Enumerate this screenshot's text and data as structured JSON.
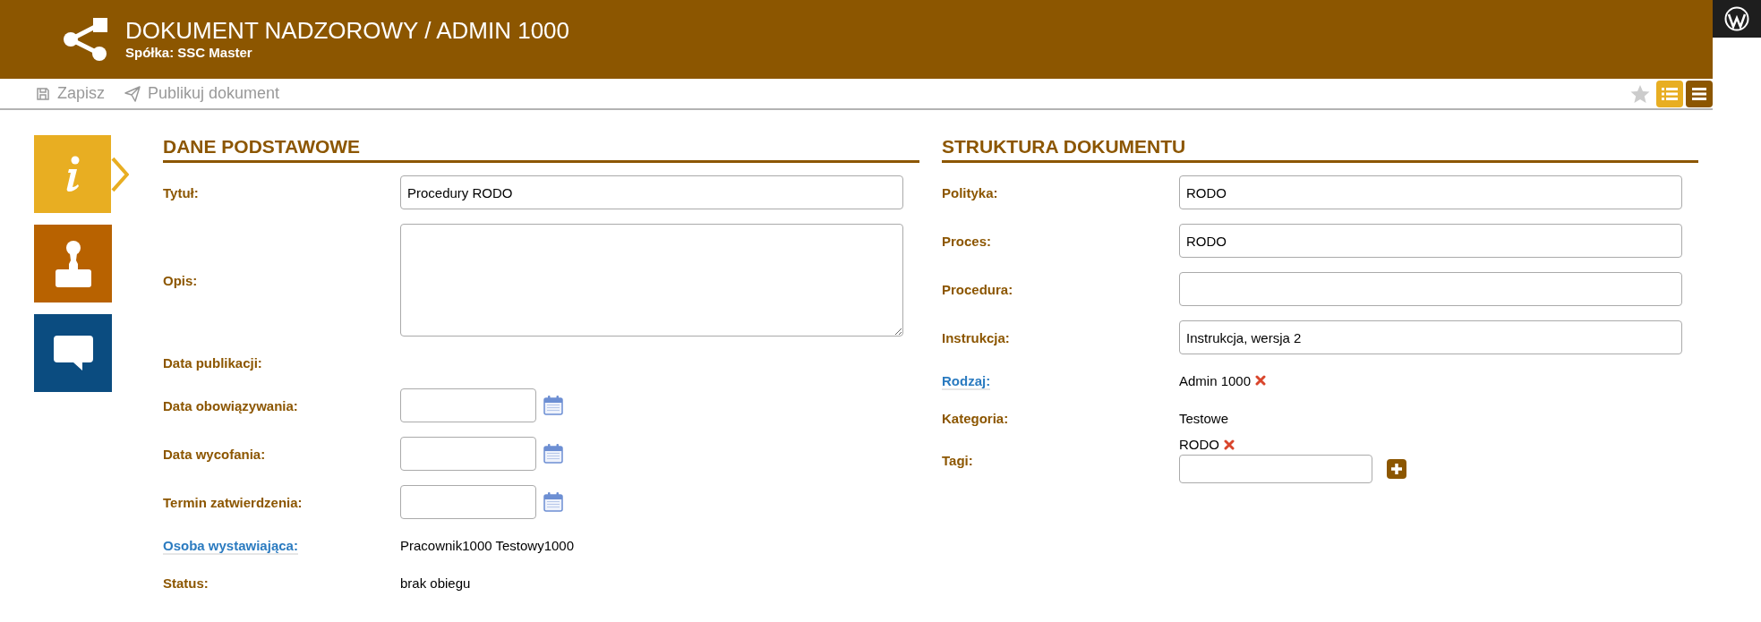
{
  "header": {
    "title": "DOKUMENT NADZOROWY / ADMIN 1000",
    "subtitle": "Spółka: SSC Master"
  },
  "toolbar": {
    "actions": [
      {
        "kind": "save",
        "label": "Zapisz"
      },
      {
        "kind": "publish",
        "label": "Publikuj dokument"
      }
    ],
    "view_buttons": [
      {
        "kind": "star",
        "selected": false
      },
      {
        "kind": "list",
        "selected": true
      },
      {
        "kind": "menu",
        "selected": false
      }
    ]
  },
  "side_nav": [
    {
      "kind": "info",
      "selected": true
    },
    {
      "kind": "stamp",
      "selected": false
    },
    {
      "kind": "comment",
      "selected": false
    }
  ],
  "sections": [
    {
      "title": "DANE PODSTAWOWE",
      "fields": [
        {
          "label": "Tytuł:",
          "kind": "input",
          "value": "Procedury RODO",
          "link": false
        },
        {
          "label": "Opis:",
          "kind": "textarea",
          "link": false
        },
        {
          "label": "Data publikacji:",
          "kind": "empty",
          "link": false
        },
        {
          "label": "Data obowiązywania:",
          "kind": "date",
          "link": false
        },
        {
          "label": "Data wycofania:",
          "kind": "date",
          "link": false
        },
        {
          "label": "Termin zatwierdzenia:",
          "kind": "date",
          "link": false
        },
        {
          "label": "Osoba wystawiająca:",
          "kind": "text",
          "value": "Pracownik1000 Testowy1000",
          "link": true
        },
        {
          "label": "Status:",
          "kind": "text",
          "value": "brak obiegu",
          "link": false
        }
      ]
    },
    {
      "title": "STRUKTURA DOKUMENTU",
      "fields": [
        {
          "label": "Polityka:",
          "kind": "input",
          "value": "RODO",
          "link": false
        },
        {
          "label": "Proces:",
          "kind": "input",
          "value": "RODO",
          "link": false
        },
        {
          "label": "Procedura:",
          "kind": "input",
          "link": false
        },
        {
          "label": "Instrukcja:",
          "kind": "input",
          "value": "Instrukcja, wersja 2",
          "link": false
        },
        {
          "label": "Rodzaj:",
          "kind": "chip",
          "value": "Admin 1000",
          "link": true
        },
        {
          "label": "Kategoria:",
          "kind": "text",
          "value": "Testowe",
          "link": false
        },
        {
          "label": "Tagi:",
          "kind": "tags",
          "tags": [
            "RODO"
          ],
          "link": false
        }
      ]
    }
  ]
}
